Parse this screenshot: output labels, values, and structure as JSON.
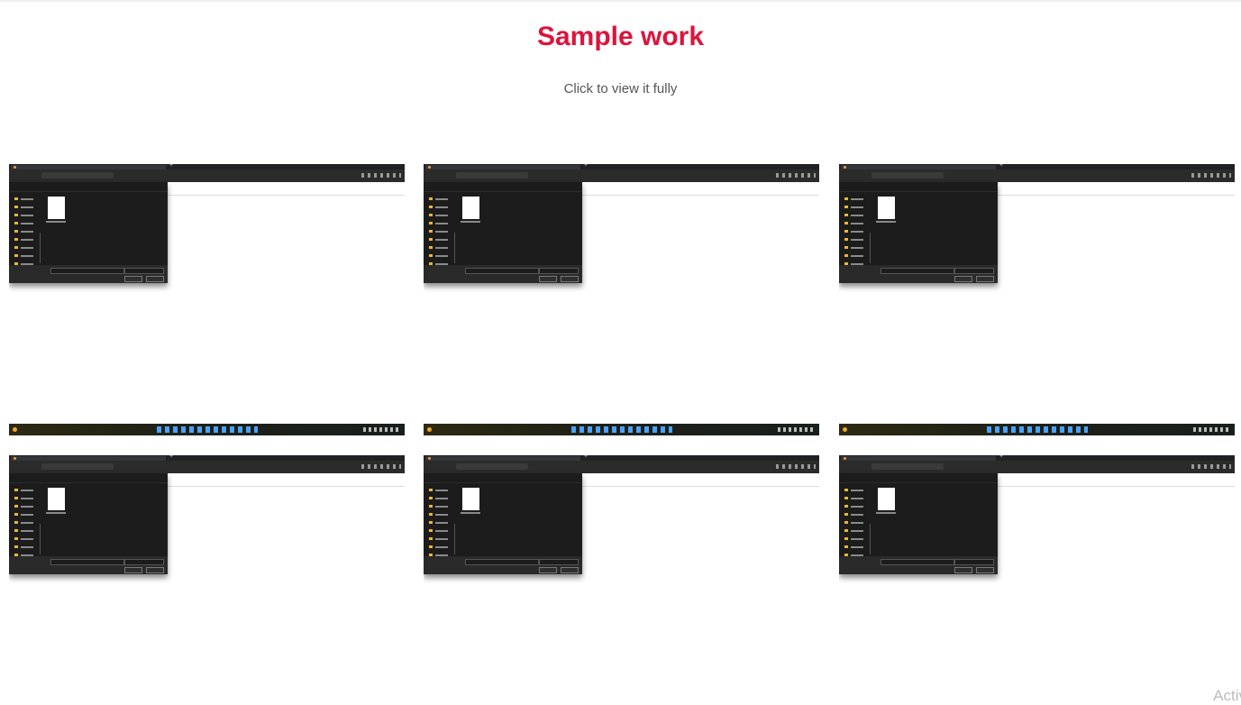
{
  "page": {
    "title": "Sample work",
    "subtitle": "Click to view it fully",
    "watermark": "Activ"
  },
  "colors": {
    "title": "#dc143c",
    "subtitle": "#555555",
    "background": "#ffffff"
  },
  "gallery": {
    "items": [
      {
        "name": "sample-work-screenshot-1"
      },
      {
        "name": "sample-work-screenshot-2"
      },
      {
        "name": "sample-work-screenshot-3"
      },
      {
        "name": "sample-work-screenshot-4"
      },
      {
        "name": "sample-work-screenshot-5"
      },
      {
        "name": "sample-work-screenshot-6"
      }
    ]
  }
}
